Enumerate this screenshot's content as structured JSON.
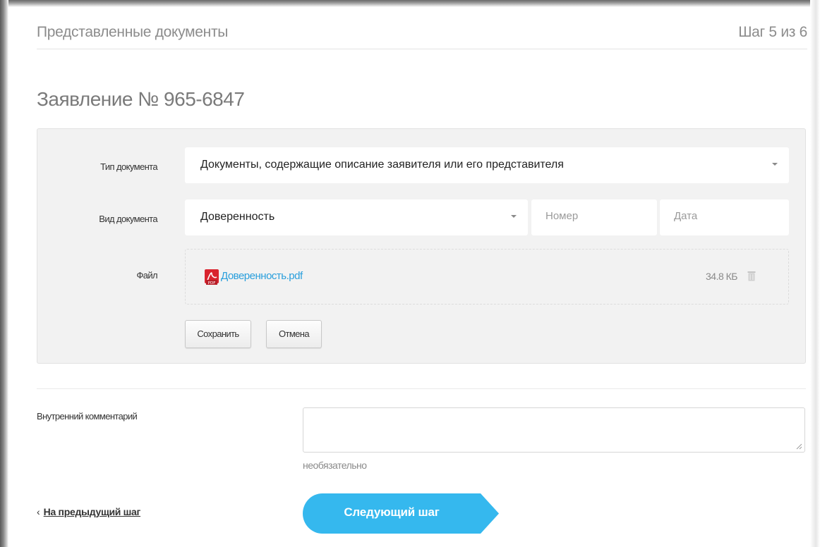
{
  "header": {
    "title": "Представленные документы",
    "step": "Шаг 5 из 6"
  },
  "application": {
    "title": "Заявление № 965-6847"
  },
  "document_form": {
    "doc_type_label": "Тип документа",
    "doc_type_value": "Документы, содержащие описание заявителя или его представителя",
    "doc_kind_label": "Вид документа",
    "doc_kind_value": "Доверенность",
    "number_placeholder": "Номер",
    "date_placeholder": "Дата",
    "file_label": "Файл",
    "file_name": "Доверенность.pdf",
    "file_size": "34.8 КБ",
    "save_label": "Сохранить",
    "cancel_label": "Отмена"
  },
  "comment": {
    "label": "Внутренний комментарий",
    "value": "",
    "hint": "необязательно"
  },
  "navigation": {
    "prev_label": "На предыдущий шаг",
    "next_label": "Следующий шаг"
  },
  "icons": {
    "file_type": "pdf-icon",
    "delete": "trash-icon",
    "dropdown": "chevron-down-icon",
    "back": "chevron-left-icon"
  },
  "colors": {
    "accent": "#35b8ee",
    "link": "#2a9fdc",
    "pdf": "#d9232e",
    "panel_bg": "#f2f2f2"
  }
}
